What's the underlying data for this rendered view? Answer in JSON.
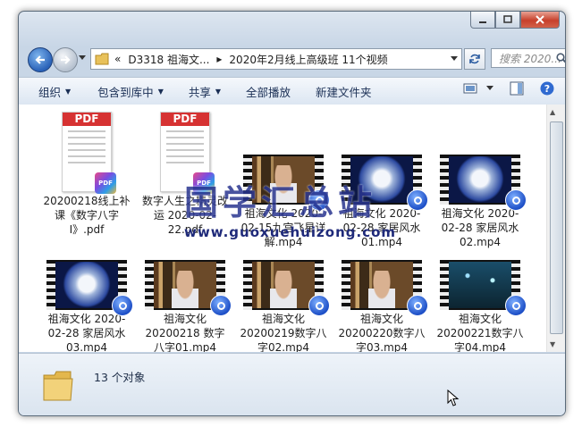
{
  "address": {
    "nav_chevron": "«",
    "segments": [
      "D3318 祖海文...",
      "2020年2月线上高级班 11个视频"
    ]
  },
  "search": {
    "placeholder": "搜索 2020..."
  },
  "toolbar": {
    "organize": "组织",
    "include_in_library": "包含到库中",
    "share": "共享",
    "play_all": "全部播放",
    "new_folder": "新建文件夹"
  },
  "files": [
    {
      "name": "20200218线上补课《数字八字I》.pdf",
      "type": "pdf"
    },
    {
      "name": "数字人生之精灵改运",
      "type": "pdf",
      "caption": "数字人生之精灵改运 2020-02-22.pdf"
    },
    {
      "name": "祖海文化2020-02-15九宫飞星详解.mp4",
      "type": "video",
      "thumb": "library"
    },
    {
      "name": "祖海文化2020-02-28 家居风水01.mp4",
      "type": "video",
      "thumb": "moon"
    },
    {
      "name": "祖海文化2020-02-28 家居风水02.mp4",
      "type": "video",
      "thumb": "moon"
    },
    {
      "name": "祖海文化2020-02-28 家居风水03.mp4",
      "type": "video",
      "thumb": "moon"
    },
    {
      "name": "祖海文化20200218 数字八字01.mp4",
      "type": "video",
      "thumb": "library"
    },
    {
      "name": "祖海文化20200219数字八字02.mp4",
      "type": "video",
      "thumb": "library"
    },
    {
      "name": "祖海文化20200220数字八字03.mp4",
      "type": "video",
      "thumb": "library"
    },
    {
      "name": "祖海文化20200221数字八字04.mp4",
      "type": "video",
      "thumb": "stars"
    }
  ],
  "labels": {
    "f0": "20200218线上补课《数字八字I》.pdf",
    "f1": "数字人生之精灵改运 2020-02-22.pdf",
    "f2": "祖海文化 2020-02-15九宫飞星详解.mp4",
    "f3": "祖海文化 2020-02-28 家居风水01.mp4",
    "f4": "祖海文化 2020-02-28 家居风水02.mp4",
    "f5": "祖海文化 2020-02-28 家居风水03.mp4",
    "f6": "祖海文化 20200218 数字八字01.mp4",
    "f7": "祖海文化 20200219数字八字02.mp4",
    "f8": "祖海文化 20200220数字八字03.mp4",
    "f9": "祖海文化 20200221数字八字04.mp4"
  },
  "pdf_badge": "PDF",
  "watermark": {
    "title": "国学汇总站",
    "url": "www.guoxuehuizong.com"
  },
  "status": {
    "count": "13 个对象"
  }
}
